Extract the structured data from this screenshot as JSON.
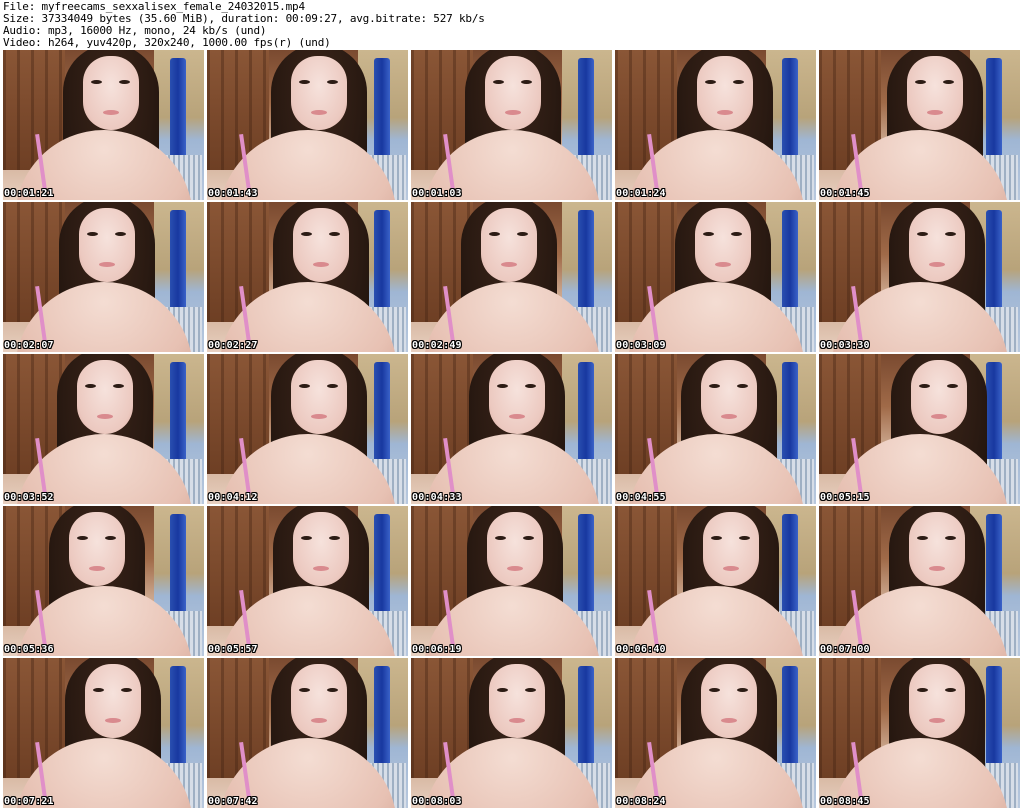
{
  "header": {
    "file_line": "File: myfreecams_sexxalisex_female_24032015.mp4",
    "size_line": "Size: 37334049 bytes (35.60 MiB), duration: 00:09:27, avg.bitrate: 527 kb/s",
    "audio_line": "Audio: mp3, 16000 Hz, mono, 24 kb/s (und)",
    "video_line": "Video: h264, yuv420p, 320x240, 1000.00 fps(r) (und)"
  },
  "grid": {
    "columns": 5,
    "rows": 5,
    "thumbnails": [
      {
        "timestamp": "00:01:21"
      },
      {
        "timestamp": "00:01:43"
      },
      {
        "timestamp": "00:01:03"
      },
      {
        "timestamp": "00:01:24"
      },
      {
        "timestamp": "00:01:45"
      },
      {
        "timestamp": "00:02:07"
      },
      {
        "timestamp": "00:02:27"
      },
      {
        "timestamp": "00:02:49"
      },
      {
        "timestamp": "00:03:09"
      },
      {
        "timestamp": "00:03:30"
      },
      {
        "timestamp": "00:03:52"
      },
      {
        "timestamp": "00:04:12"
      },
      {
        "timestamp": "00:04:33"
      },
      {
        "timestamp": "00:04:55"
      },
      {
        "timestamp": "00:05:15"
      },
      {
        "timestamp": "00:05:36"
      },
      {
        "timestamp": "00:05:57"
      },
      {
        "timestamp": "00:06:19"
      },
      {
        "timestamp": "00:06:40"
      },
      {
        "timestamp": "00:07:00"
      },
      {
        "timestamp": "00:07:21"
      },
      {
        "timestamp": "00:07:42"
      },
      {
        "timestamp": "00:08:03"
      },
      {
        "timestamp": "00:08:24"
      },
      {
        "timestamp": "00:08:45"
      }
    ]
  }
}
